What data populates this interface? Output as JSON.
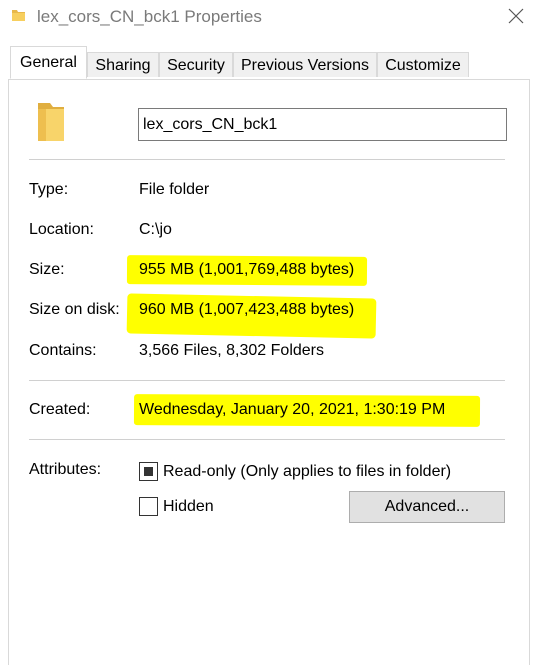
{
  "window": {
    "title": "lex_cors_CN_bck1 Properties",
    "folder_icon": "folder-icon",
    "close_icon": "close-icon"
  },
  "tabs": [
    {
      "label": "General",
      "active": true
    },
    {
      "label": "Sharing",
      "active": false
    },
    {
      "label": "Security",
      "active": false
    },
    {
      "label": "Previous Versions",
      "active": false
    },
    {
      "label": "Customize",
      "active": false
    }
  ],
  "general": {
    "folder_name": "lex_cors_CN_bck1",
    "type_label": "Type:",
    "type_value": "File folder",
    "location_label": "Location:",
    "location_value": "C:\\jo",
    "size_label": "Size:",
    "size_value": "955 MB (1,001,769,488 bytes)",
    "size_on_disk_label": "Size on disk:",
    "size_on_disk_value": "960 MB (1,007,423,488 bytes)",
    "contains_label": "Contains:",
    "contains_value": "3,566 Files, 8,302 Folders",
    "created_label": "Created:",
    "created_value": "Wednesday, January 20, 2021, 1:30:19 PM",
    "attributes_label": "Attributes:",
    "readonly_label": "Read-only (Only applies to files in folder)",
    "readonly_state": "indeterminate",
    "hidden_label": "Hidden",
    "hidden_checked": false,
    "advanced_label": "Advanced..."
  },
  "colors": {
    "highlight": "#ffff00",
    "folder": "#f7cf5e",
    "title_text": "#7a7a7a"
  }
}
